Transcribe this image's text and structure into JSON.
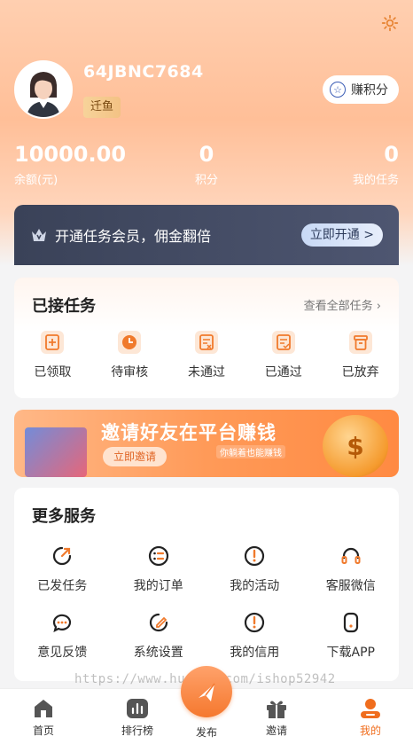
{
  "profile": {
    "username": "64JBNC7684",
    "level": "迁鱼",
    "earn_points": "赚积分"
  },
  "stats": [
    {
      "value": "10000.00",
      "label": "余额(元)"
    },
    {
      "value": "0",
      "label": "积分"
    },
    {
      "value": "0",
      "label": "我的任务"
    }
  ],
  "vip": {
    "text": "开通任务会员，佣金翻倍",
    "button": "立即开通 >"
  },
  "tasks": {
    "title": "已接任务",
    "view_all": "查看全部任务 ›",
    "items": [
      {
        "label": "已领取",
        "icon": "claimed-icon"
      },
      {
        "label": "待审核",
        "icon": "pending-review-icon"
      },
      {
        "label": "未通过",
        "icon": "rejected-icon"
      },
      {
        "label": "已通过",
        "icon": "approved-icon"
      },
      {
        "label": "已放弃",
        "icon": "abandoned-icon"
      }
    ]
  },
  "banner": {
    "title": "邀请好友在平台赚钱",
    "button": "立即邀请",
    "subtitle": "你躺着也能赚钱"
  },
  "services": {
    "title": "更多服务",
    "items": [
      {
        "label": "已发任务",
        "icon": "published-task-icon"
      },
      {
        "label": "我的订单",
        "icon": "order-icon"
      },
      {
        "label": "我的活动",
        "icon": "activity-icon"
      },
      {
        "label": "客服微信",
        "icon": "headset-icon"
      },
      {
        "label": "意见反馈",
        "icon": "feedback-icon"
      },
      {
        "label": "系统设置",
        "icon": "settings-icon"
      },
      {
        "label": "我的信用",
        "icon": "credit-icon"
      },
      {
        "label": "下载APP",
        "icon": "download-app-icon"
      }
    ]
  },
  "watermark": "https://www.huzhan.com/ishop52942",
  "tabbar": {
    "home": "首页",
    "ranking": "排行榜",
    "publish": "发布",
    "invite": "邀请",
    "mine": "我的"
  },
  "colors": {
    "accent": "#f06d1d",
    "vip_bar": "#3a4258"
  }
}
